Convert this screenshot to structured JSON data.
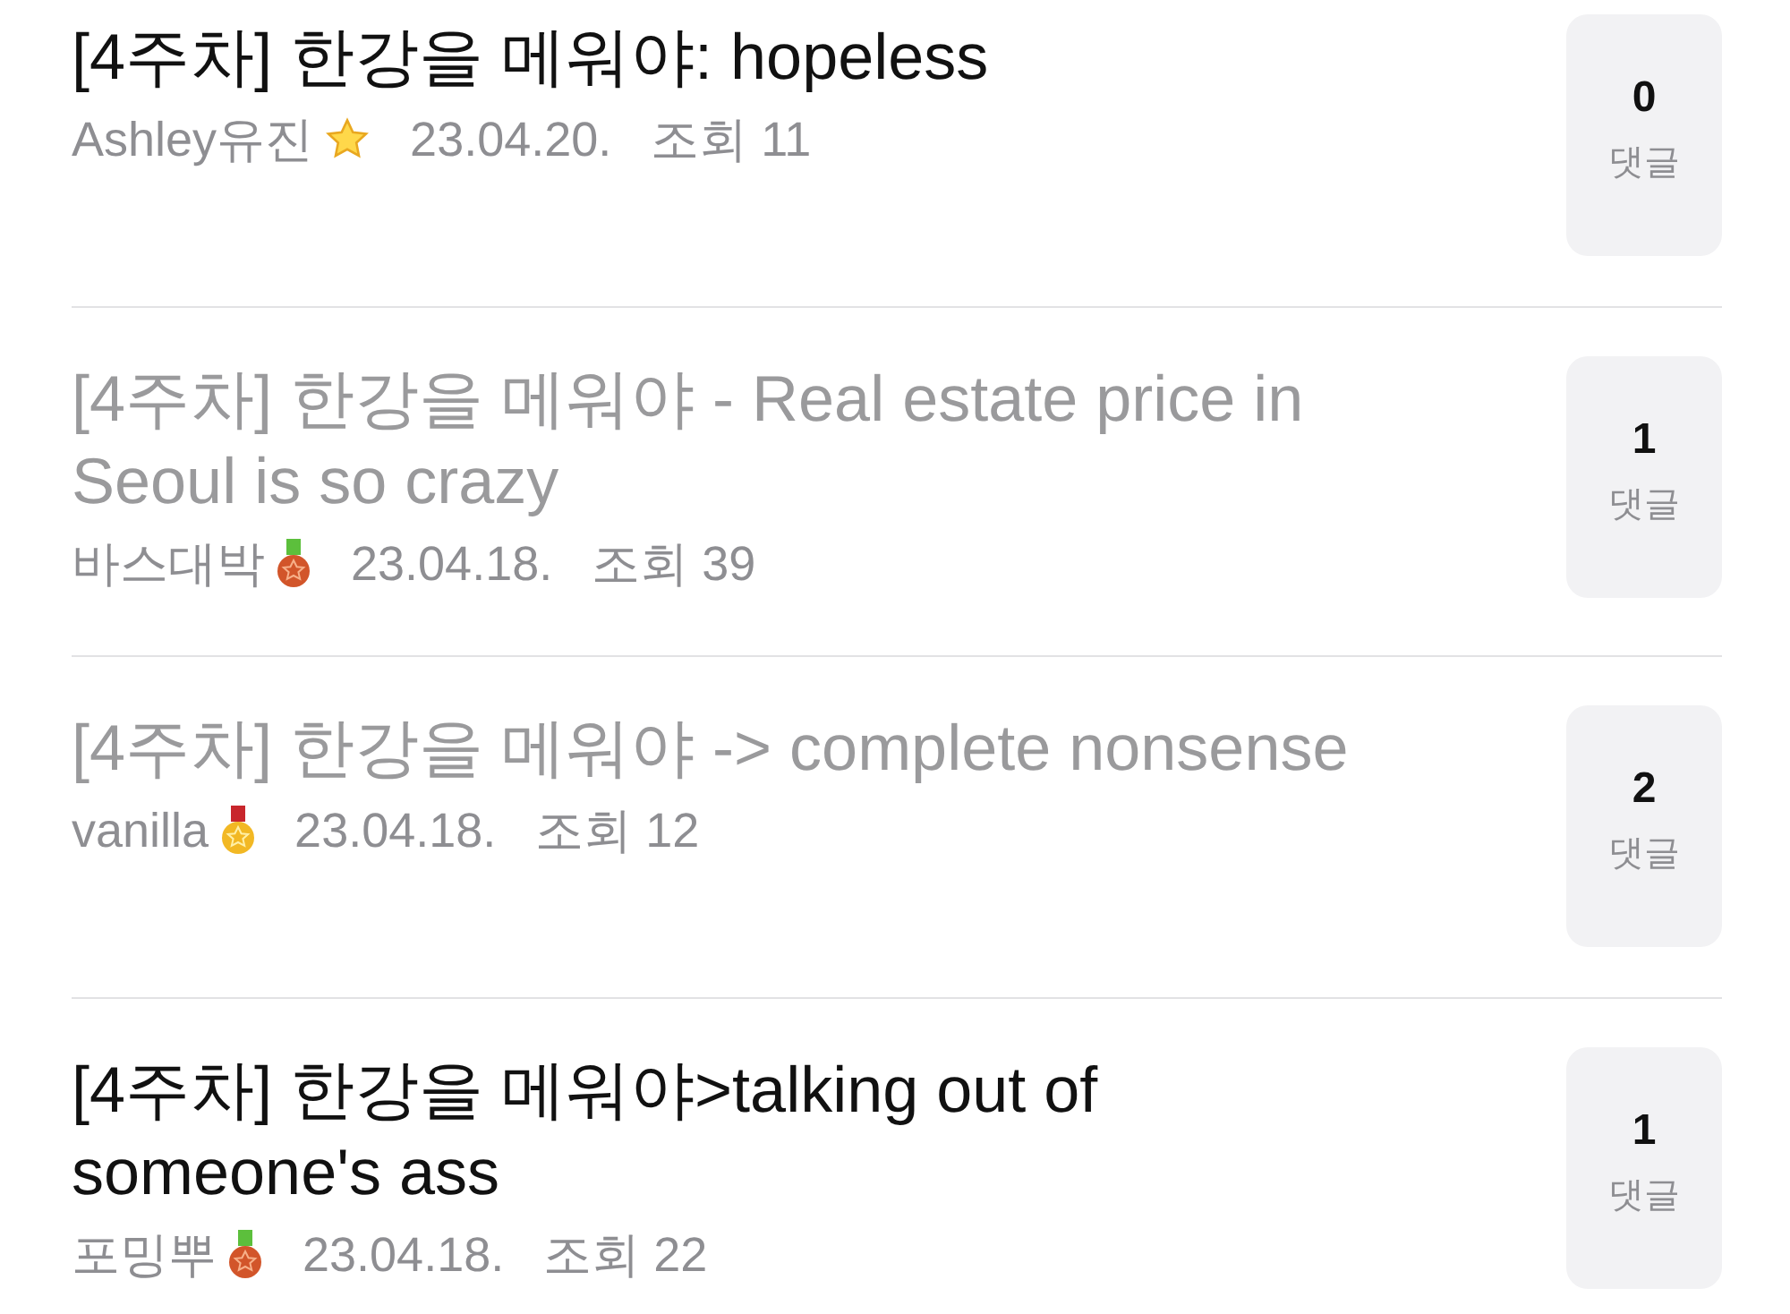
{
  "posts": [
    {
      "title": "[4주차] 한강을 메워야: hopeless",
      "read": false,
      "author": "Ashley유진",
      "badge": {
        "kind": "star"
      },
      "date": "23.04.20.",
      "views": "조회 11",
      "comments": "0",
      "comments_label": "댓글"
    },
    {
      "title": "[4주차] 한강을 메워야 - Real estate price in Seoul is so crazy",
      "read": true,
      "author": "바스대박",
      "badge": {
        "kind": "bronze"
      },
      "date": "23.04.18.",
      "views": "조회 39",
      "comments": "1",
      "comments_label": "댓글"
    },
    {
      "title": "[4주차] 한강을 메워야 -> complete nonsense",
      "read": true,
      "author": "vanilla",
      "badge": {
        "kind": "gold"
      },
      "date": "23.04.18.",
      "views": "조회 12",
      "comments": "2",
      "comments_label": "댓글"
    },
    {
      "title": "[4주차] 한강을 메워야>talking out of someone's ass",
      "read": false,
      "author": "포밍뿌",
      "badge": {
        "kind": "bronze"
      },
      "date": "23.04.18.",
      "views": "조회 22",
      "comments": "1",
      "comments_label": "댓글"
    }
  ]
}
